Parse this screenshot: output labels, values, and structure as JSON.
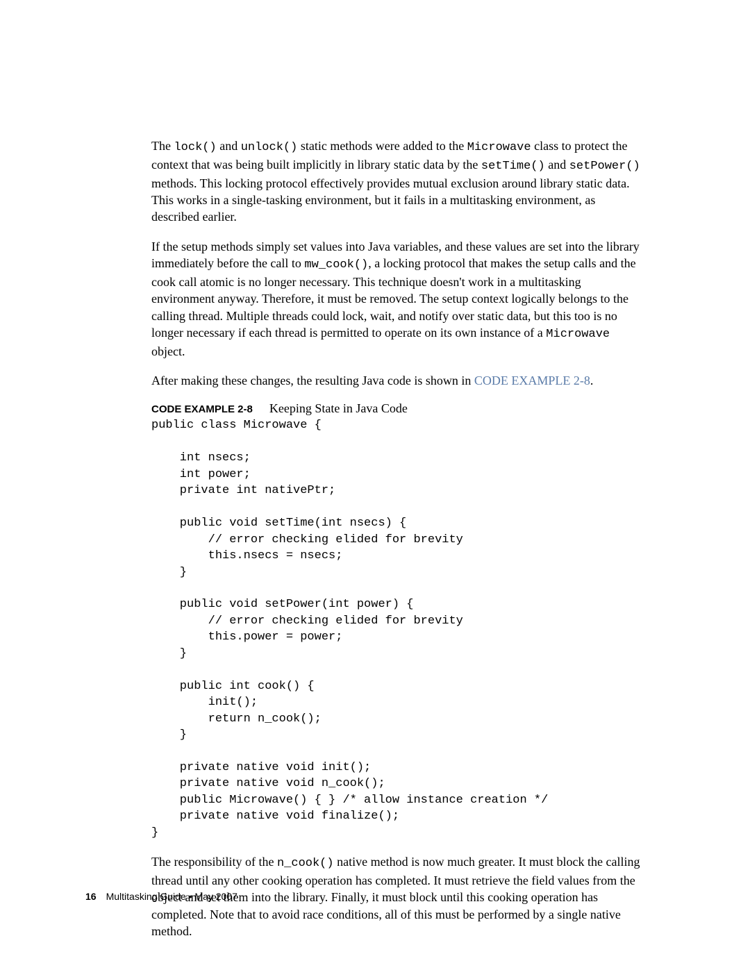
{
  "paragraphs": {
    "p1_part1": "The ",
    "p1_code1": "lock()",
    "p1_part2": " and ",
    "p1_code2": "unlock()",
    "p1_part3": " static methods were added to the ",
    "p1_code3": "Microwave",
    "p1_part4": " class to protect the context that was being built implicitly in library static data by the ",
    "p1_code4": "setTime()",
    "p1_part5": " and ",
    "p1_code5": "setPower()",
    "p1_part6": " methods. This locking protocol effectively provides mutual exclusion around library static data. This works in a single-tasking environment, but it fails in a multitasking environment, as described earlier.",
    "p2_part1": "If the setup methods simply set values into Java variables, and these values are set into the library immediately before the call to ",
    "p2_code1": "mw_cook()",
    "p2_part2": ", a locking protocol that makes the setup calls and the cook call atomic is no longer necessary. This technique doesn't work in a multitasking environment anyway. Therefore, it must be removed. The setup context logically belongs to the calling thread. Multiple threads could lock, wait, and notify over static data, but this too is no longer necessary if each thread is permitted to operate on its own instance of a ",
    "p2_code2": "Microwave",
    "p2_part3": " object.",
    "p3_part1": "After making these changes, the resulting Java code is shown in ",
    "p3_link": "CODE EXAMPLE 2-8",
    "p3_part2": ".",
    "p4_part1": "The responsibility of the ",
    "p4_code1": "n_cook()",
    "p4_part2": " native method is now much greater. It must block the calling thread until any other cooking operation has completed. It must retrieve the field values from the object and set them into the library. Finally, it must block until this cooking operation has completed. Note that to avoid race conditions, all of this must be performed by a single native method."
  },
  "example": {
    "label": "CODE EXAMPLE 2-8",
    "title": "Keeping State in Java Code",
    "code": "public class Microwave {\n\n    int nsecs;\n    int power;\n    private int nativePtr;\n\n    public void setTime(int nsecs) {\n        // error checking elided for brevity\n        this.nsecs = nsecs;\n    }\n\n    public void setPower(int power) {\n        // error checking elided for brevity\n        this.power = power;\n    }\n\n    public int cook() {\n        init();\n        return n_cook();\n    }\n\n    private native void init();\n    private native void n_cook();\n    public Microwave() { } /* allow instance creation */\n    private native void finalize();\n}"
  },
  "footer": {
    "page_number": "16",
    "doc_title": "Multitasking Guide • May 2007"
  }
}
